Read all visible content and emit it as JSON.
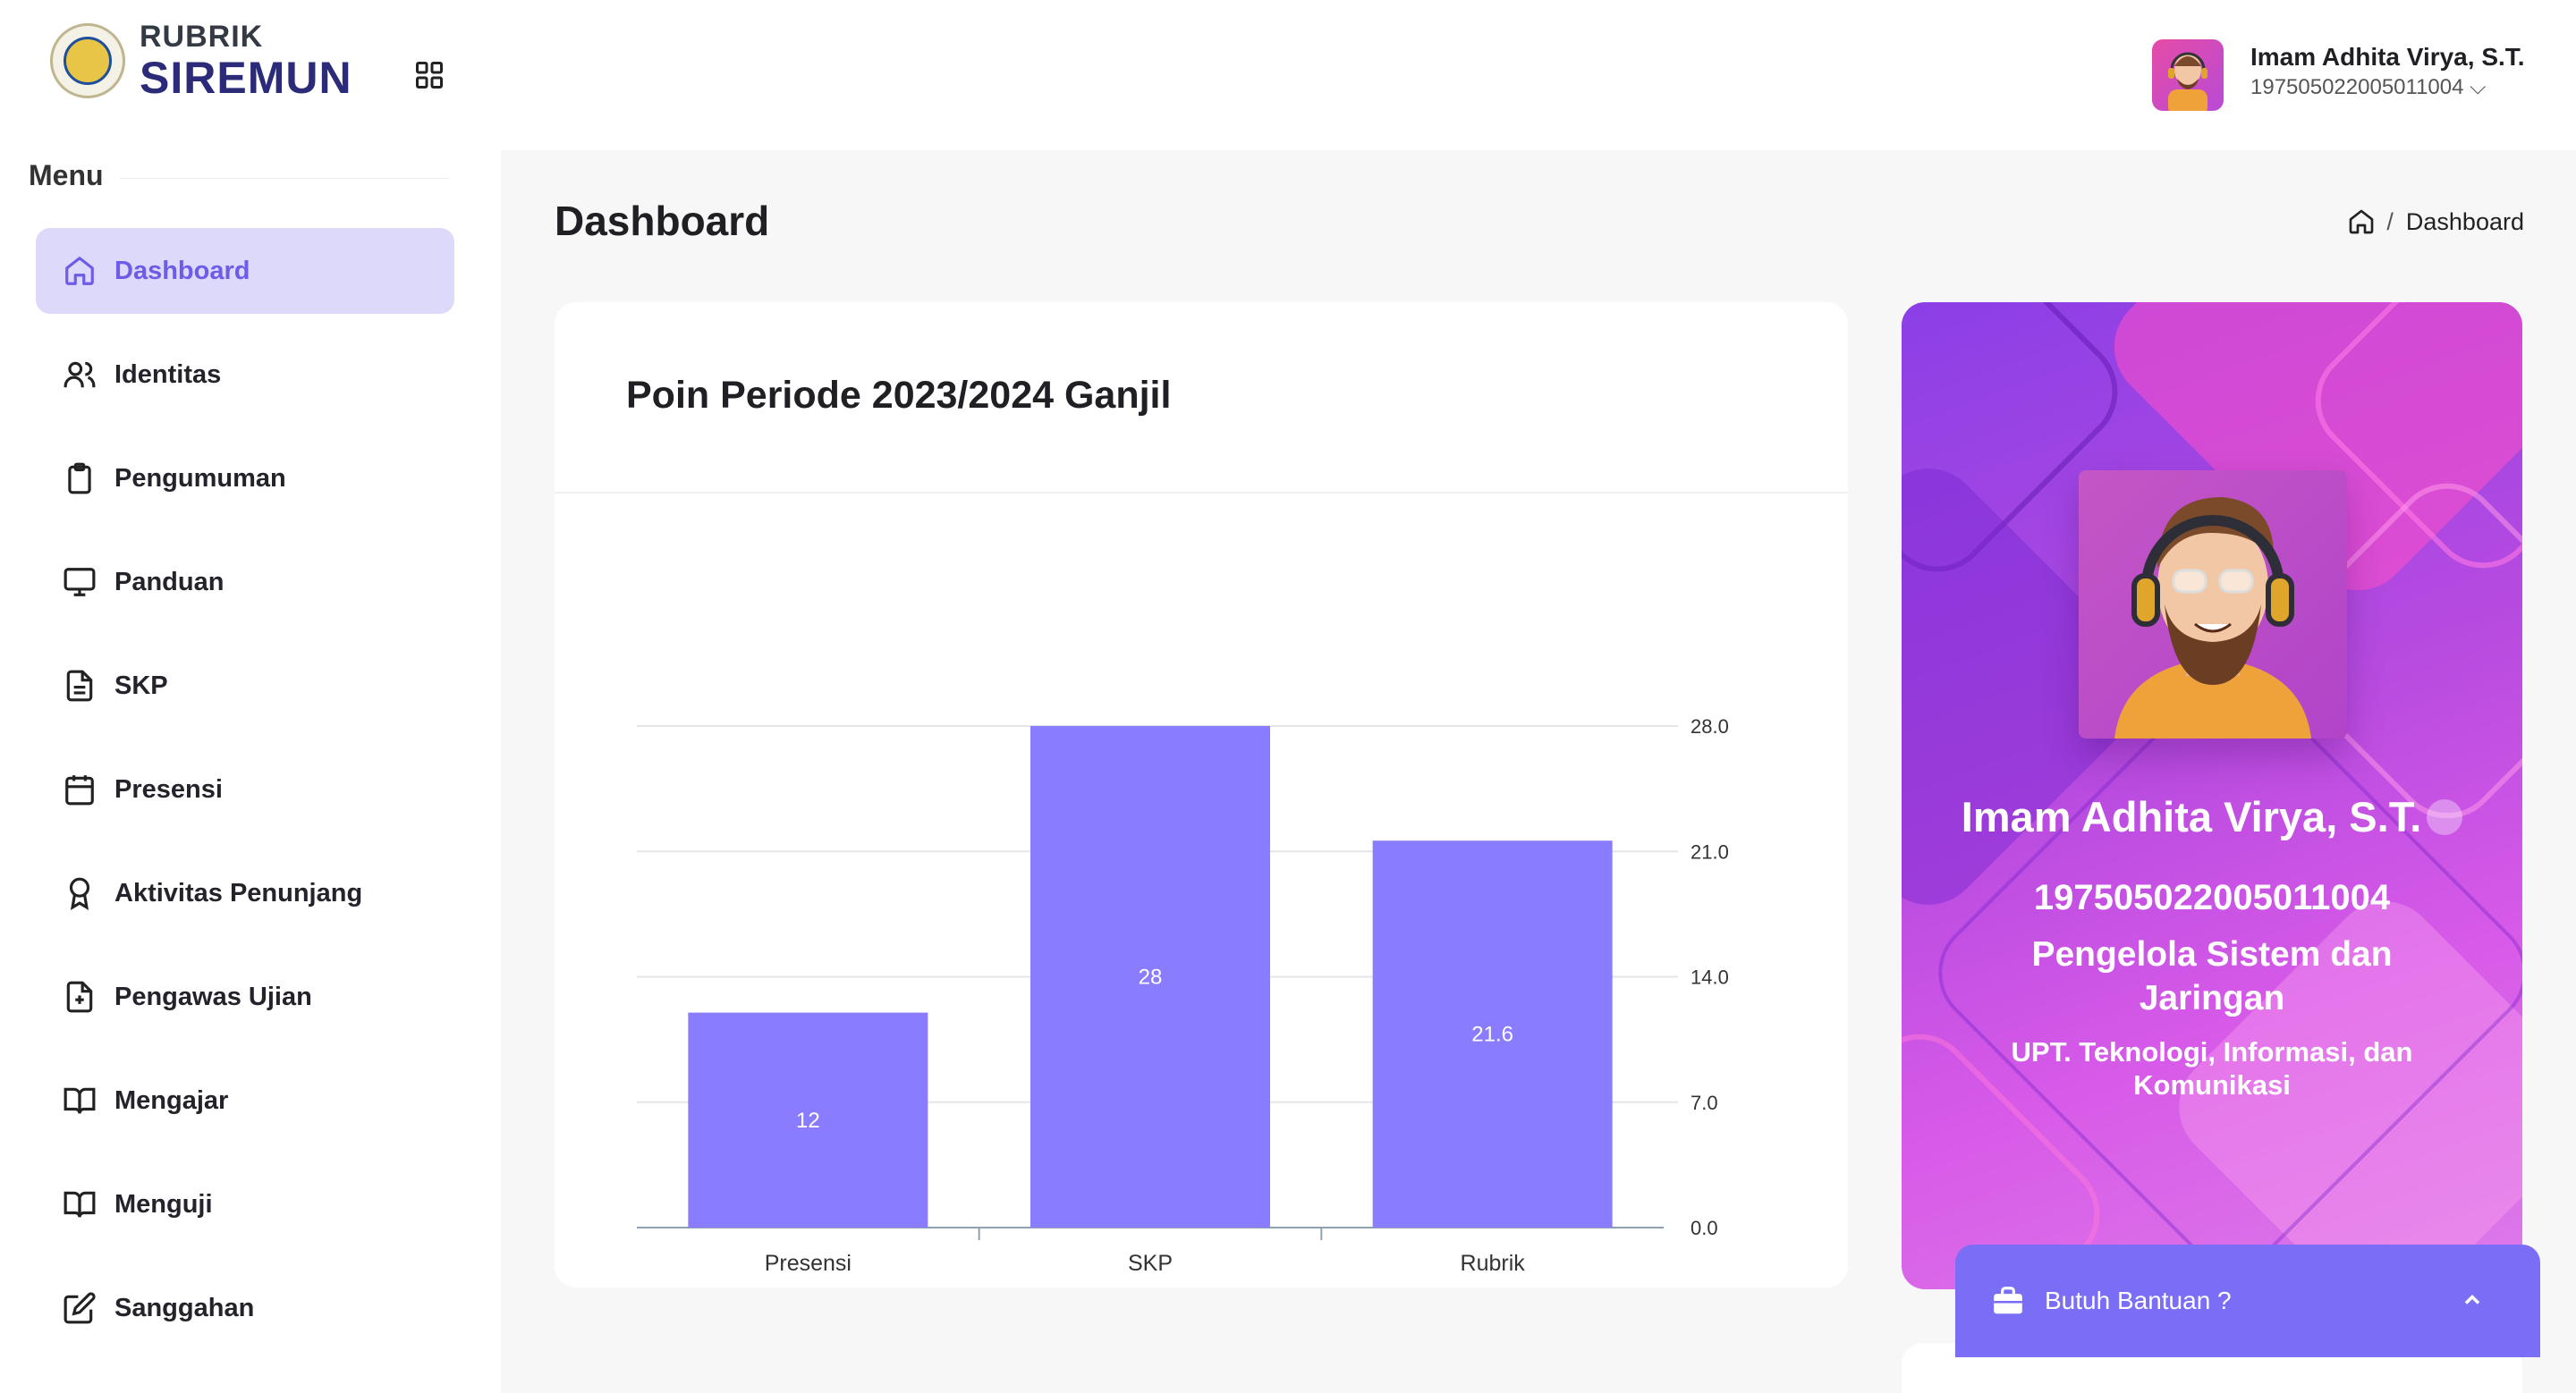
{
  "brand": {
    "line1": "RUBRIK",
    "line2": "SIREMUN"
  },
  "menu": {
    "heading": "Menu",
    "items": [
      {
        "label": "Dashboard",
        "icon": "home-icon",
        "active": true
      },
      {
        "label": "Identitas",
        "icon": "users-icon"
      },
      {
        "label": "Pengumuman",
        "icon": "clipboard-icon"
      },
      {
        "label": "Panduan",
        "icon": "monitor-icon"
      },
      {
        "label": "SKP",
        "icon": "document-icon"
      },
      {
        "label": "Presensi",
        "icon": "calendar-icon"
      },
      {
        "label": "Aktivitas Penunjang",
        "icon": "award-icon"
      },
      {
        "label": "Pengawas Ujian",
        "icon": "file-plus-icon"
      },
      {
        "label": "Mengajar",
        "icon": "book-open-icon"
      },
      {
        "label": "Menguji",
        "icon": "book-open-icon"
      },
      {
        "label": "Sanggahan",
        "icon": "edit-icon"
      }
    ]
  },
  "header": {
    "user_name": "Imam Adhita Virya, S.T.",
    "user_id": "197505022005011004 ⌵"
  },
  "page": {
    "title": "Dashboard",
    "breadcrumb_current": "Dashboard",
    "breadcrumb_sep": "/"
  },
  "chart_card": {
    "title": "Poin Periode 2023/2024 Ganjil"
  },
  "chart_data": {
    "type": "bar",
    "categories": [
      "Presensi",
      "SKP",
      "Rubrik"
    ],
    "values": [
      12,
      28,
      21.6
    ],
    "value_labels": [
      "12",
      "28",
      "21.6"
    ],
    "ylim": [
      0,
      28
    ],
    "yticks": [
      "0.0",
      "7.0",
      "14.0",
      "21.0",
      "28.0"
    ],
    "ytick_values": [
      0,
      7,
      14,
      21,
      28
    ],
    "y_axis_side": "right",
    "grid": true,
    "bar_color": "#8a7cff"
  },
  "profile": {
    "name": "Imam Adhita Virya, S.T.",
    "nip": "197505022005011004",
    "role": "Pengelola Sistem dan Jaringan",
    "unit": "UPT. Teknologi, Informasi, dan Komunikasi"
  },
  "help": {
    "label": "Butuh Bantuan ?"
  },
  "colors": {
    "accent": "#6c5ce7",
    "active_bg": "#ddd9fb",
    "bar": "#8a7cff",
    "help_bg": "#7b6ef6"
  }
}
